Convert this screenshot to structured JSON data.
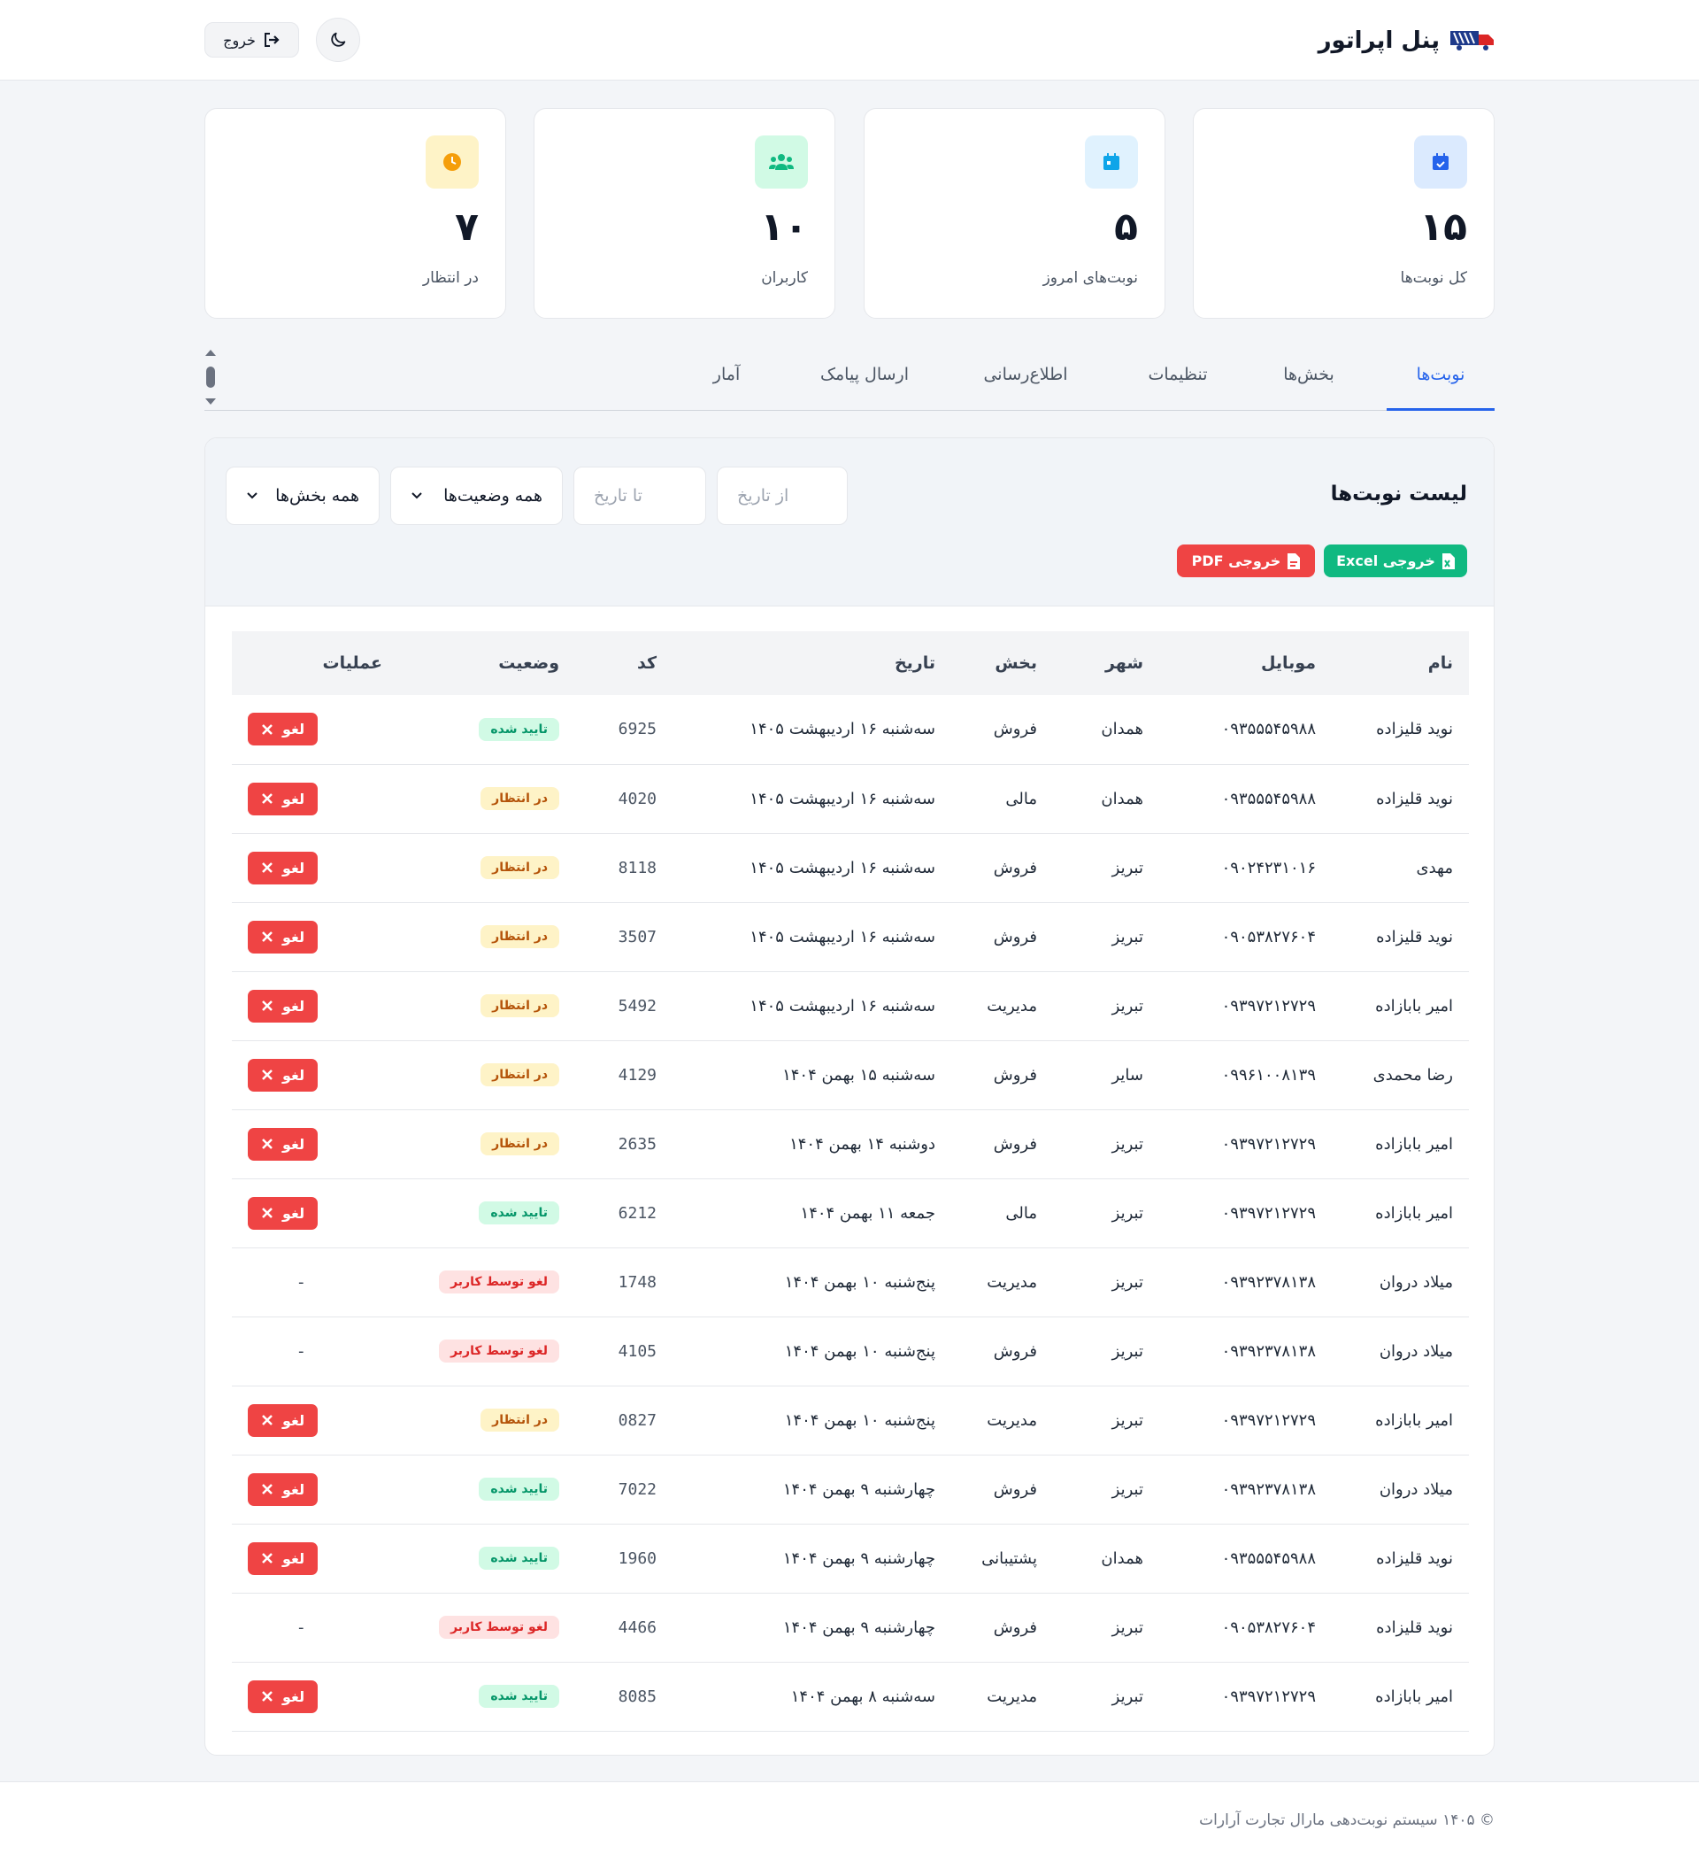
{
  "header": {
    "title": "پنل اپراتور",
    "logout_label": "خروج",
    "logo_icon": "truck-logo-icon",
    "theme_icon": "moon-icon",
    "logout_icon": "sign-out-icon"
  },
  "stats": [
    {
      "value": "۱۵",
      "label": "کل نوبت‌ها",
      "icon": "calendar-check-icon",
      "bg": "#dbeafe",
      "color": "#2563eb"
    },
    {
      "value": "۵",
      "label": "نوبت‌های امروز",
      "icon": "calendar-day-icon",
      "bg": "#e0f2fe",
      "color": "#0284c7"
    },
    {
      "value": "۱۰",
      "label": "کاربران",
      "icon": "users-icon",
      "bg": "#d1fae5",
      "color": "#10b981"
    },
    {
      "value": "۷",
      "label": "در انتظار",
      "icon": "clock-icon",
      "bg": "#fef3c7",
      "color": "#f59e0b"
    }
  ],
  "tabs": [
    "نوبت‌ها",
    "بخش‌ها",
    "تنظیمات",
    "اطلاع‌رسانی",
    "ارسال پیامک",
    "آمار"
  ],
  "panel": {
    "title": "لیست نوبت‌ها",
    "from_placeholder": "از تاریخ",
    "to_placeholder": "تا تاریخ",
    "status_filter": "همه وضعیت‌ها",
    "section_filter": "همه بخش‌ها",
    "excel_label": "خروجی Excel",
    "pdf_label": "خروجی PDF"
  },
  "table": {
    "headers": [
      "نام",
      "موبایل",
      "شهر",
      "بخش",
      "تاریخ",
      "کد",
      "وضعیت",
      "عملیات"
    ],
    "cancel_label": "لغو",
    "rows": [
      {
        "name": "نوید قلیزاده",
        "mobile": "۰۹۳۵۵۵۴۵۹۸۸",
        "city": "همدان",
        "section": "فروش",
        "date": "سه‌شنبه ۱۶ اردیبهشت ۱۴۰۵",
        "code": "6925",
        "status": "تایید شده",
        "status_type": "ok",
        "action": "cancel"
      },
      {
        "name": "نوید قلیزاده",
        "mobile": "۰۹۳۵۵۵۴۵۹۸۸",
        "city": "همدان",
        "section": "مالی",
        "date": "سه‌شنبه ۱۶ اردیبهشت ۱۴۰۵",
        "code": "4020",
        "status": "در انتظار",
        "status_type": "wait",
        "action": "cancel"
      },
      {
        "name": "مهدی",
        "mobile": "۰۹۰۲۴۲۳۱۰۱۶",
        "city": "تبریز",
        "section": "فروش",
        "date": "سه‌شنبه ۱۶ اردیبهشت ۱۴۰۵",
        "code": "8118",
        "status": "در انتظار",
        "status_type": "wait",
        "action": "cancel"
      },
      {
        "name": "نوید قلیزاده",
        "mobile": "۰۹۰۵۳۸۲۷۶۰۴",
        "city": "تبریز",
        "section": "فروش",
        "date": "سه‌شنبه ۱۶ اردیبهشت ۱۴۰۵",
        "code": "3507",
        "status": "در انتظار",
        "status_type": "wait",
        "action": "cancel"
      },
      {
        "name": "امیر بابازاده",
        "mobile": "۰۹۳۹۷۲۱۲۷۲۹",
        "city": "تبریز",
        "section": "مدیریت",
        "date": "سه‌شنبه ۱۶ اردیبهشت ۱۴۰۵",
        "code": "5492",
        "status": "در انتظار",
        "status_type": "wait",
        "action": "cancel"
      },
      {
        "name": "رضا محمدی",
        "mobile": "۰۹۹۶۱۰۰۸۱۳۹",
        "city": "سایر",
        "section": "فروش",
        "date": "سه‌شنبه ۱۵ بهمن ۱۴۰۴",
        "code": "4129",
        "status": "در انتظار",
        "status_type": "wait",
        "action": "cancel"
      },
      {
        "name": "امیر بابازاده",
        "mobile": "۰۹۳۹۷۲۱۲۷۲۹",
        "city": "تبریز",
        "section": "فروش",
        "date": "دوشنبه ۱۴ بهمن ۱۴۰۴",
        "code": "2635",
        "status": "در انتظار",
        "status_type": "wait",
        "action": "cancel"
      },
      {
        "name": "امیر بابازاده",
        "mobile": "۰۹۳۹۷۲۱۲۷۲۹",
        "city": "تبریز",
        "section": "مالی",
        "date": "جمعه ۱۱ بهمن ۱۴۰۴",
        "code": "6212",
        "status": "تایید شده",
        "status_type": "ok",
        "action": "cancel"
      },
      {
        "name": "میلاد دروان",
        "mobile": "۰۹۳۹۲۳۷۸۱۳۸",
        "city": "تبریز",
        "section": "مدیریت",
        "date": "پنج‌شنبه ۱۰ بهمن ۱۴۰۴",
        "code": "1748",
        "status": "لغو توسط کاربر",
        "status_type": "cancel",
        "action": "none"
      },
      {
        "name": "میلاد دروان",
        "mobile": "۰۹۳۹۲۳۷۸۱۳۸",
        "city": "تبریز",
        "section": "فروش",
        "date": "پنج‌شنبه ۱۰ بهمن ۱۴۰۴",
        "code": "4105",
        "status": "لغو توسط کاربر",
        "status_type": "cancel",
        "action": "none"
      },
      {
        "name": "امیر بابازاده",
        "mobile": "۰۹۳۹۷۲۱۲۷۲۹",
        "city": "تبریز",
        "section": "مدیریت",
        "date": "پنج‌شنبه ۱۰ بهمن ۱۴۰۴",
        "code": "0827",
        "status": "در انتظار",
        "status_type": "wait",
        "action": "cancel"
      },
      {
        "name": "میلاد دروان",
        "mobile": "۰۹۳۹۲۳۷۸۱۳۸",
        "city": "تبریز",
        "section": "فروش",
        "date": "چهارشنبه ۹ بهمن ۱۴۰۴",
        "code": "7022",
        "status": "تایید شده",
        "status_type": "ok",
        "action": "cancel"
      },
      {
        "name": "نوید قلیزاده",
        "mobile": "۰۹۳۵۵۵۴۵۹۸۸",
        "city": "همدان",
        "section": "پشتیبانی",
        "date": "چهارشنبه ۹ بهمن ۱۴۰۴",
        "code": "1960",
        "status": "تایید شده",
        "status_type": "ok",
        "action": "cancel"
      },
      {
        "name": "نوید قلیزاده",
        "mobile": "۰۹۰۵۳۸۲۷۶۰۴",
        "city": "تبریز",
        "section": "فروش",
        "date": "چهارشنبه ۹ بهمن ۱۴۰۴",
        "code": "4466",
        "status": "لغو توسط کاربر",
        "status_type": "cancel",
        "action": "none"
      },
      {
        "name": "امیر بابازاده",
        "mobile": "۰۹۳۹۷۲۱۲۷۲۹",
        "city": "تبریز",
        "section": "مدیریت",
        "date": "سه‌شنبه ۸ بهمن ۱۴۰۴",
        "code": "8085",
        "status": "تایید شده",
        "status_type": "ok",
        "action": "cancel"
      }
    ]
  },
  "footer": {
    "text": "© ۱۴۰۵ سیستم نوبت‌دهی مارال تجارت آرارات"
  },
  "colors": {
    "accent": "#2563eb",
    "danger": "#ef4444",
    "success": "#10b981"
  }
}
